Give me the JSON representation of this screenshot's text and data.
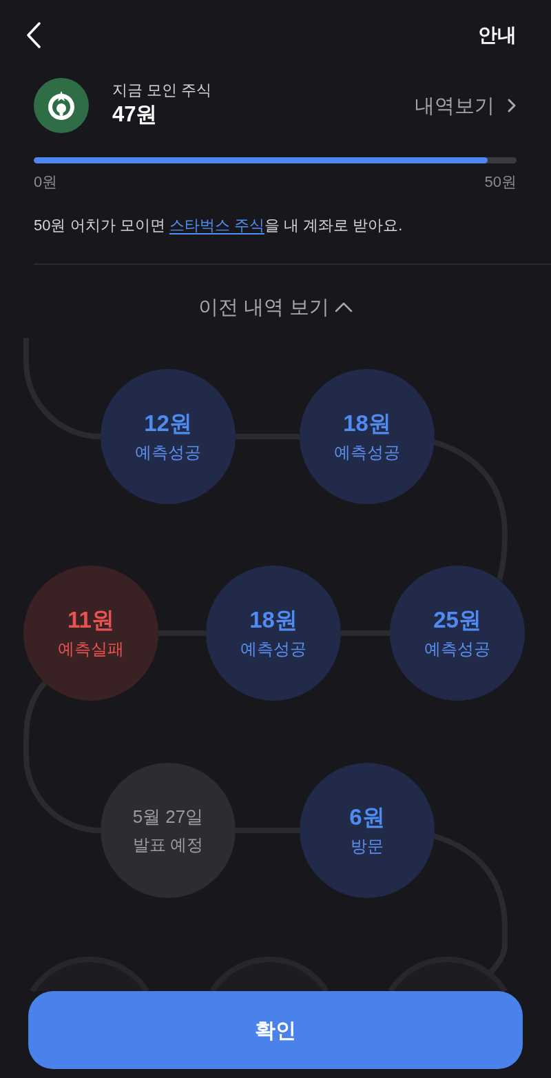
{
  "header": {
    "info_link": "안내"
  },
  "summary": {
    "label": "지금 모인 주식",
    "amount": "47원",
    "history_link": "내역보기"
  },
  "progress": {
    "level": 0.94,
    "min_label": "0원",
    "max_label": "50원"
  },
  "notice": {
    "text_before": "50원 어치가 모이면 ",
    "link": "스타벅스 주식",
    "text_after": "을 내 계좌로 받아요."
  },
  "toggle": {
    "label": "이전 내역 보기",
    "expanded": true
  },
  "nodes": [
    {
      "kind": "success",
      "amount": "12원",
      "status": "예측성공"
    },
    {
      "kind": "success",
      "amount": "18원",
      "status": "예측성공"
    },
    {
      "kind": "failure",
      "amount": "11원",
      "status": "예측실패"
    },
    {
      "kind": "success",
      "amount": "18원",
      "status": "예측성공"
    },
    {
      "kind": "success",
      "amount": "25원",
      "status": "예측성공"
    },
    {
      "kind": "pending",
      "date": "5월 27일",
      "status": "발표 예정"
    },
    {
      "kind": "visit",
      "amount": "6원",
      "status": "방문"
    },
    {
      "kind": "faded"
    },
    {
      "kind": "faded"
    },
    {
      "kind": "faded"
    }
  ],
  "confirm_button": "확인"
}
